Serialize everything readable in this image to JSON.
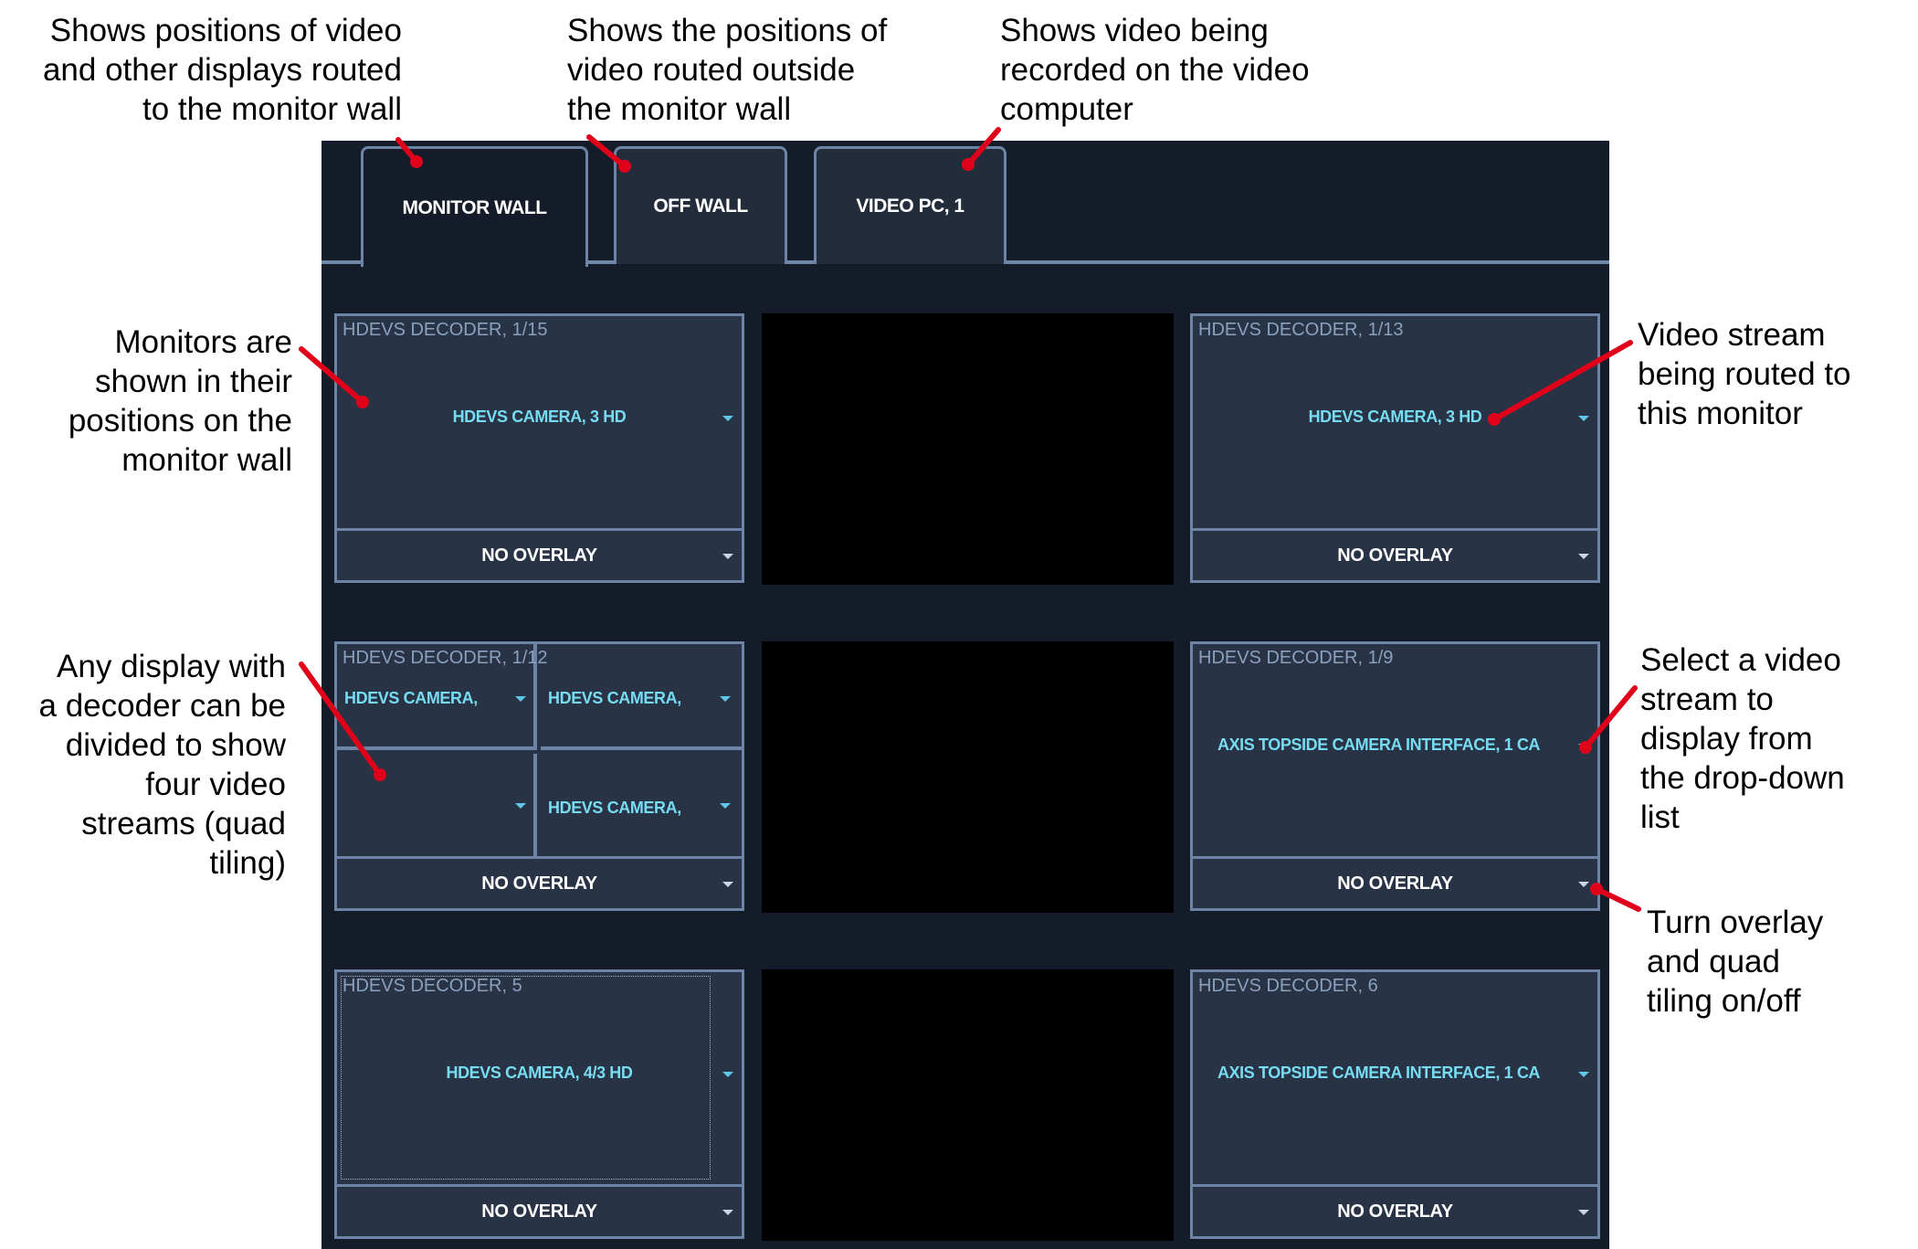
{
  "annotations": {
    "monitor_wall_tab": [
      "Shows positions of video",
      "and other displays routed",
      "to the monitor wall"
    ],
    "off_wall_tab": [
      "Shows the positions of",
      "video routed outside",
      "the monitor wall"
    ],
    "video_pc_tab": [
      "Shows video being",
      "recorded on the video",
      "computer"
    ],
    "monitor_positions": [
      "Monitors are",
      "shown in their",
      "positions on the",
      "monitor wall"
    ],
    "video_stream": [
      "Video stream",
      "being routed to",
      "this monitor"
    ],
    "quad_tiling": [
      "Any display with",
      "a decoder can be",
      "divided to show",
      "four video",
      "streams (quad",
      "tiling)"
    ],
    "select_stream": [
      "Select a video",
      "stream to",
      "display from",
      "the drop-down",
      "list"
    ],
    "overlay_toggle": [
      "Turn overlay",
      "and quad",
      "tiling on/off"
    ]
  },
  "tabs": [
    {
      "label": "MONITOR WALL",
      "active": true
    },
    {
      "label": "OFF WALL",
      "active": false
    },
    {
      "label": "VIDEO PC, 1",
      "active": false
    }
  ],
  "monitors": {
    "top_left": {
      "title": "HDEVS DECODER, 1/15",
      "stream": "HDEVS CAMERA, 3 HD",
      "overlay": "NO OVERLAY"
    },
    "top_right": {
      "title": "HDEVS DECODER, 1/13",
      "stream": "HDEVS CAMERA, 3 HD",
      "overlay": "NO OVERLAY"
    },
    "mid_left": {
      "title": "HDEVS DECODER, 1/12",
      "quads": [
        "HDEVS CAMERA,",
        "HDEVS CAMERA,",
        "",
        "HDEVS CAMERA,"
      ],
      "overlay": "NO OVERLAY"
    },
    "mid_right": {
      "title": "HDEVS DECODER, 1/9",
      "stream": "AXIS TOPSIDE CAMERA INTERFACE, 1 CA",
      "overlay": "NO OVERLAY"
    },
    "bot_left": {
      "title": "HDEVS DECODER, 5",
      "stream": "HDEVS CAMERA, 4/3 HD",
      "overlay": "NO OVERLAY"
    },
    "bot_right": {
      "title": "HDEVS DECODER, 6",
      "stream": "AXIS TOPSIDE CAMERA INTERFACE, 1 CA",
      "overlay": "NO OVERLAY"
    }
  },
  "colors": {
    "app_background": "#131c28",
    "panel": "#283345",
    "border": "#6d84a6",
    "stream_text": "#77dcf2",
    "annotation_arrow": "#e0001a"
  }
}
